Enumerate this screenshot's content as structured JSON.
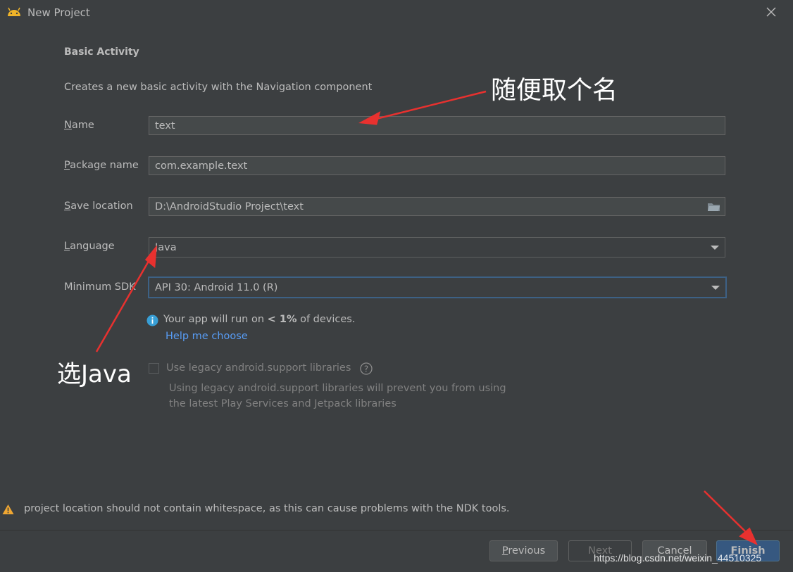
{
  "window": {
    "title": "New Project"
  },
  "form": {
    "section_title": "Basic Activity",
    "description": "Creates a new basic activity with the Navigation component",
    "name": {
      "label_mn": "N",
      "label_rest": "ame",
      "value": "text"
    },
    "package": {
      "label_mn": "P",
      "label_rest": "ackage name",
      "value": "com.example.text"
    },
    "save_location": {
      "label_mn": "S",
      "label_rest": "ave location",
      "value": "D:\\AndroidStudio Project\\text"
    },
    "language": {
      "label_mn": "L",
      "label_rest": "anguage",
      "value": "Java"
    },
    "min_sdk": {
      "label": "Minimum SDK",
      "value": "API 30: Android 11.0 (R)"
    },
    "sdk_info": {
      "prefix": "Your app will run on",
      "bold": "< 1%",
      "suffix": "of devices."
    },
    "help_link": "Help me choose",
    "legacy": {
      "label": "Use legacy android.support libraries",
      "checked": false,
      "note_line1": "Using legacy android.support libraries will prevent you from using",
      "note_line2": "the latest Play Services and Jetpack libraries"
    }
  },
  "warning": "project location should not contain whitespace, as this can cause problems with the NDK tools.",
  "buttons": {
    "previous": {
      "mn": "P",
      "rest": "revious"
    },
    "next": "Next",
    "cancel": "Cancel",
    "finish": {
      "mn": "F",
      "rest": "inish"
    }
  },
  "annotations": {
    "name_hint": "随便取个名",
    "language_hint": "选Java"
  },
  "watermark": "https://blog.csdn.net/weixin_44510325",
  "colors": {
    "background": "#3c3f41",
    "field_bg": "#45494a",
    "link": "#589df6",
    "focus_border": "#3d6185",
    "primary_button": "#365880",
    "arrow": "#e8312f"
  }
}
